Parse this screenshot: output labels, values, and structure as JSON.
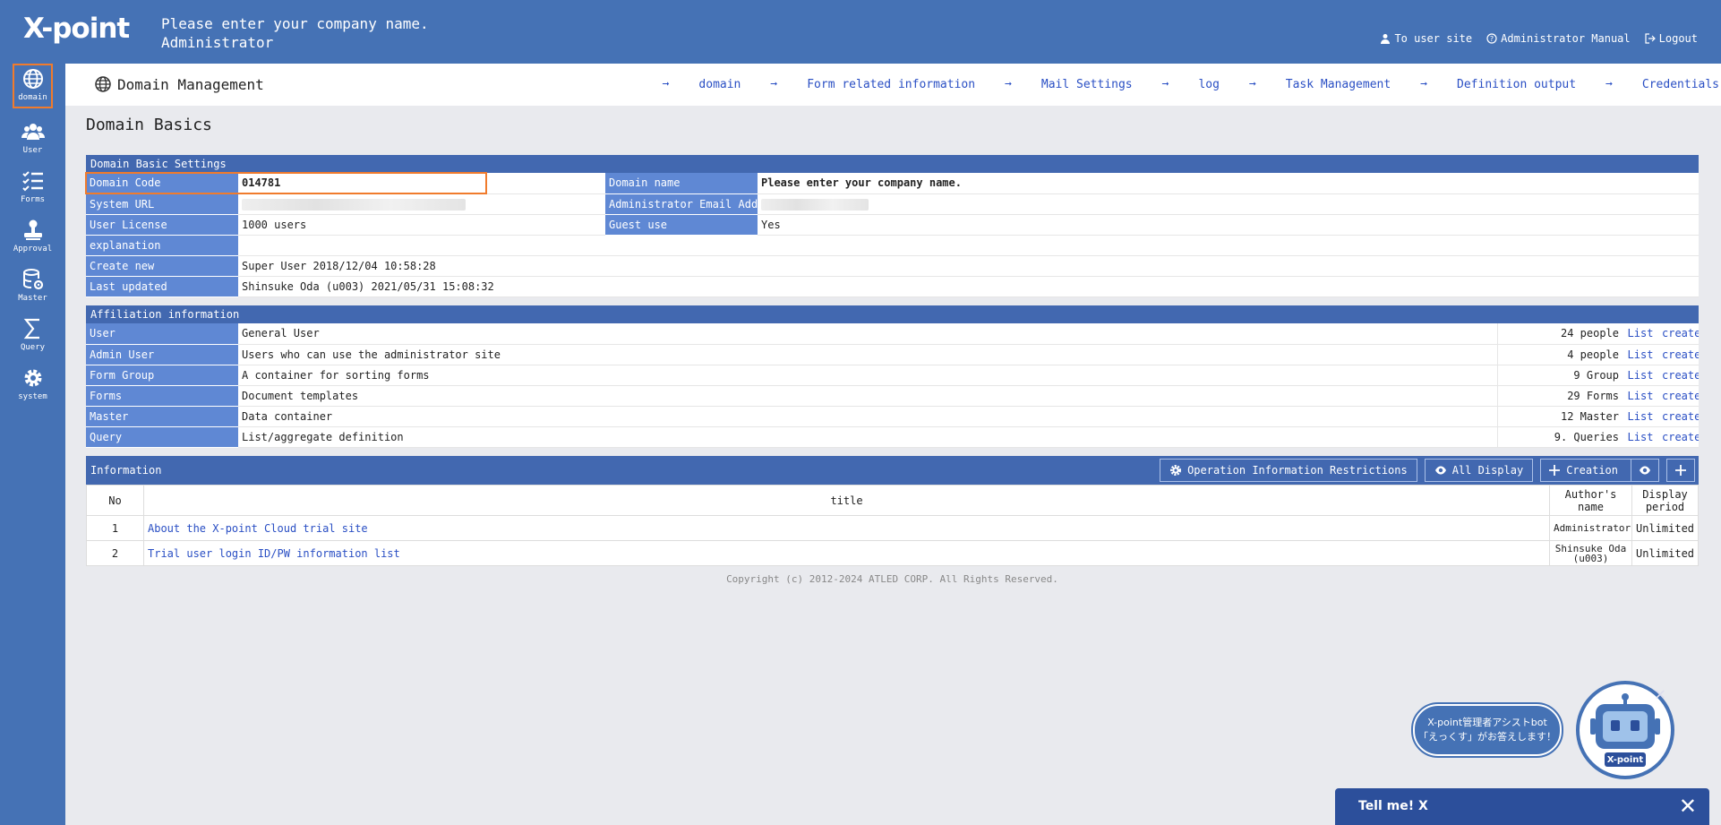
{
  "app": {
    "logo": "X-point",
    "company_name": "Please enter your company name.",
    "role": "Administrator"
  },
  "top_links": {
    "user_site": "To user site",
    "admin_manual": "Administrator Manual",
    "logout": "Logout"
  },
  "left_nav": [
    {
      "label": "domain",
      "icon": "globe-icon"
    },
    {
      "label": "User",
      "icon": "users-icon"
    },
    {
      "label": "Forms",
      "icon": "checklist-icon"
    },
    {
      "label": "Approval",
      "icon": "stamp-icon"
    },
    {
      "label": "Master",
      "icon": "database-gear-icon"
    },
    {
      "label": "Query",
      "icon": "sigma-icon"
    },
    {
      "label": "system",
      "icon": "gear-icon"
    }
  ],
  "subheader": {
    "title": "Domain Management",
    "links": [
      "domain",
      "Form related information",
      "Mail Settings",
      "log",
      "Task Management",
      "Definition output",
      "Credentials"
    ]
  },
  "page_heading": "Domain Basics",
  "basic_settings": {
    "header": "Domain Basic Settings",
    "domain_code_label": "Domain Code",
    "domain_code_value": "014781",
    "domain_name_label": "Domain name",
    "domain_name_value": "Please enter your company name.",
    "system_url_label": "System URL",
    "admin_email_label": "Administrator Email Address",
    "user_license_label": "User License",
    "user_license_value": "1000 users",
    "guest_use_label": "Guest use",
    "guest_use_value": "Yes",
    "explanation_label": "explanation",
    "explanation_value": "",
    "create_new_label": "Create new",
    "create_new_value": "Super User 2018/12/04 10:58:28",
    "last_updated_label": "Last updated",
    "last_updated_value": "Shinsuke Oda (u003) 2021/05/31 15:08:32"
  },
  "affiliation": {
    "header": "Affiliation information",
    "list_label": "List",
    "create_label": "create",
    "rows": [
      {
        "name": "User",
        "desc": "General User",
        "count": "24 people"
      },
      {
        "name": "Admin User",
        "desc": "Users who can use the administrator site",
        "count": "4 people"
      },
      {
        "name": "Form Group",
        "desc": "A container for sorting forms",
        "count": "9 Group"
      },
      {
        "name": "Forms",
        "desc": "Document templates",
        "count": "29 Forms"
      },
      {
        "name": "Master",
        "desc": "Data container",
        "count": "12 Master"
      },
      {
        "name": "Query",
        "desc": "List/aggregate definition",
        "count": "9. Queries"
      }
    ]
  },
  "information": {
    "header": "Information",
    "btn_restrictions": "Operation Information Restrictions",
    "btn_all_display": "All Display",
    "btn_creation": "Creation",
    "columns": {
      "no": "No",
      "title": "title",
      "author": "Author's name",
      "period": "Display period"
    },
    "rows": [
      {
        "no": "1",
        "title": "About the X-point Cloud trial site",
        "author": "Administrator",
        "period": "Unlimited"
      },
      {
        "no": "2",
        "title": "Trial user login ID/PW information list",
        "author": "Shinsuke Oda (u003)",
        "period": "Unlimited"
      }
    ]
  },
  "footer": "Copyright (c) 2012-2024 ATLED CORP. All Rights Reserved.",
  "assistant": {
    "bubble_line1": "X-point管理者アシストbot",
    "bubble_line2": "「えっくす」がお答えします！",
    "badge": "X-point",
    "chat_title": "Tell me! X"
  }
}
